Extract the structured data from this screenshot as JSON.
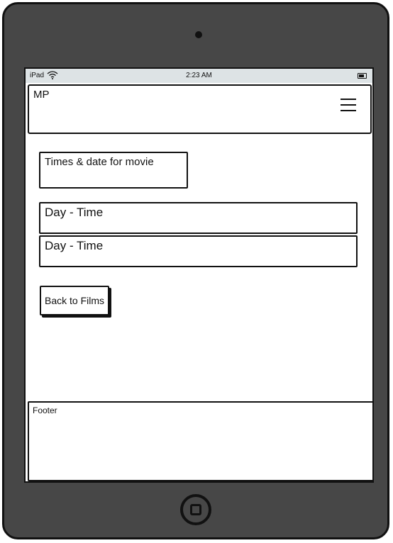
{
  "statusbar": {
    "device": "iPad",
    "time": "2:23 AM"
  },
  "header": {
    "logo": "MP"
  },
  "main": {
    "title": "Times & date for movie",
    "showings": [
      {
        "label": "Day - Time"
      },
      {
        "label": "Day - Time"
      }
    ],
    "back_button": "Back to Films"
  },
  "footer": {
    "label": "Footer"
  },
  "icons": {
    "wifi": "wifi-icon",
    "battery": "battery-icon",
    "menu": "hamburger-icon",
    "home": "home-button-icon"
  }
}
